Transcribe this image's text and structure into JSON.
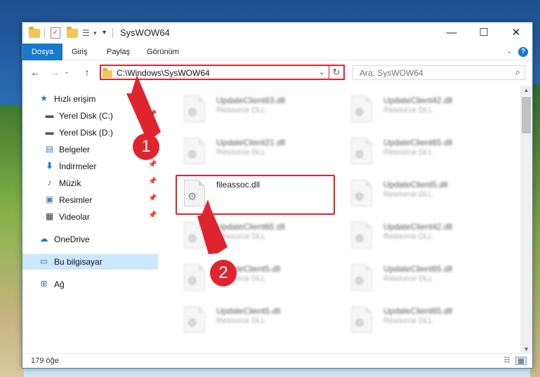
{
  "window": {
    "title": "SysWOW64",
    "minimize": "—",
    "maximize": "☐",
    "close": "✕"
  },
  "ribbon": {
    "tabs": [
      "Dosya",
      "Giriş",
      "Paylaş",
      "Görünüm"
    ],
    "help": "?",
    "collapse": "⌄"
  },
  "nav": {
    "back": "←",
    "forward": "→",
    "recent": "⌄",
    "up": "↑",
    "address": "C:\\Windows\\SysWOW64",
    "address_dropdown": "⌄",
    "refresh": "↻",
    "search_placeholder": "Ara: SysWOW64",
    "search_icon": "⌕"
  },
  "sidebar": {
    "quick_access": {
      "label": "Hızlı erişim",
      "icon": "star-icon"
    },
    "items": [
      {
        "label": "Yerel Disk (C:)",
        "icon": "drive-icon",
        "pinned": true
      },
      {
        "label": "Yerel Disk (D:)",
        "icon": "drive-icon",
        "pinned": true
      },
      {
        "label": "Belgeler",
        "icon": "document-icon",
        "pinned": true
      },
      {
        "label": "İndirmeler",
        "icon": "download-icon",
        "pinned": true
      },
      {
        "label": "Müzik",
        "icon": "music-icon",
        "pinned": true
      },
      {
        "label": "Resimler",
        "icon": "picture-icon",
        "pinned": true
      },
      {
        "label": "Videolar",
        "icon": "video-icon",
        "pinned": true
      }
    ],
    "onedrive": {
      "label": "OneDrive",
      "icon": "cloud-icon"
    },
    "this_pc": {
      "label": "Bu bilgisayar",
      "icon": "computer-icon"
    },
    "network": {
      "label": "Ağ",
      "icon": "network-icon"
    }
  },
  "files": [
    {
      "name": "UpdateClient63.dll",
      "type": "Resource DLL",
      "blurred": true
    },
    {
      "name": "UpdateClient42.dll",
      "type": "Resource DLL",
      "blurred": true
    },
    {
      "name": "UpdateClient21.dll",
      "type": "Resource DLL",
      "blurred": true
    },
    {
      "name": "UpdateClient65.dll",
      "type": "Resource DLL",
      "blurred": true
    },
    {
      "name": "fileassoc.dll",
      "type": "",
      "blurred": false
    },
    {
      "name": "UpdateClient5.dll",
      "type": "Resource DLL",
      "blurred": true
    },
    {
      "name": "UpdateClient65.dll",
      "type": "Resource DLL",
      "blurred": true
    },
    {
      "name": "UpdateClient42.dll",
      "type": "Resource DLL",
      "blurred": true
    },
    {
      "name": "UpdateClient5.dll",
      "type": "Resource DLL",
      "blurred": true
    },
    {
      "name": "UpdateClient65.dll",
      "type": "Resource DLL",
      "blurred": true
    },
    {
      "name": "UpdateClient5.dll",
      "type": "Resource DLL",
      "blurred": true
    },
    {
      "name": "UpdateClient65.dll",
      "type": "Resource DLL",
      "blurred": true
    }
  ],
  "status": {
    "item_count": "179 öğe"
  },
  "annotations": {
    "step1": "1",
    "step2": "2",
    "color": "#e0242d"
  }
}
